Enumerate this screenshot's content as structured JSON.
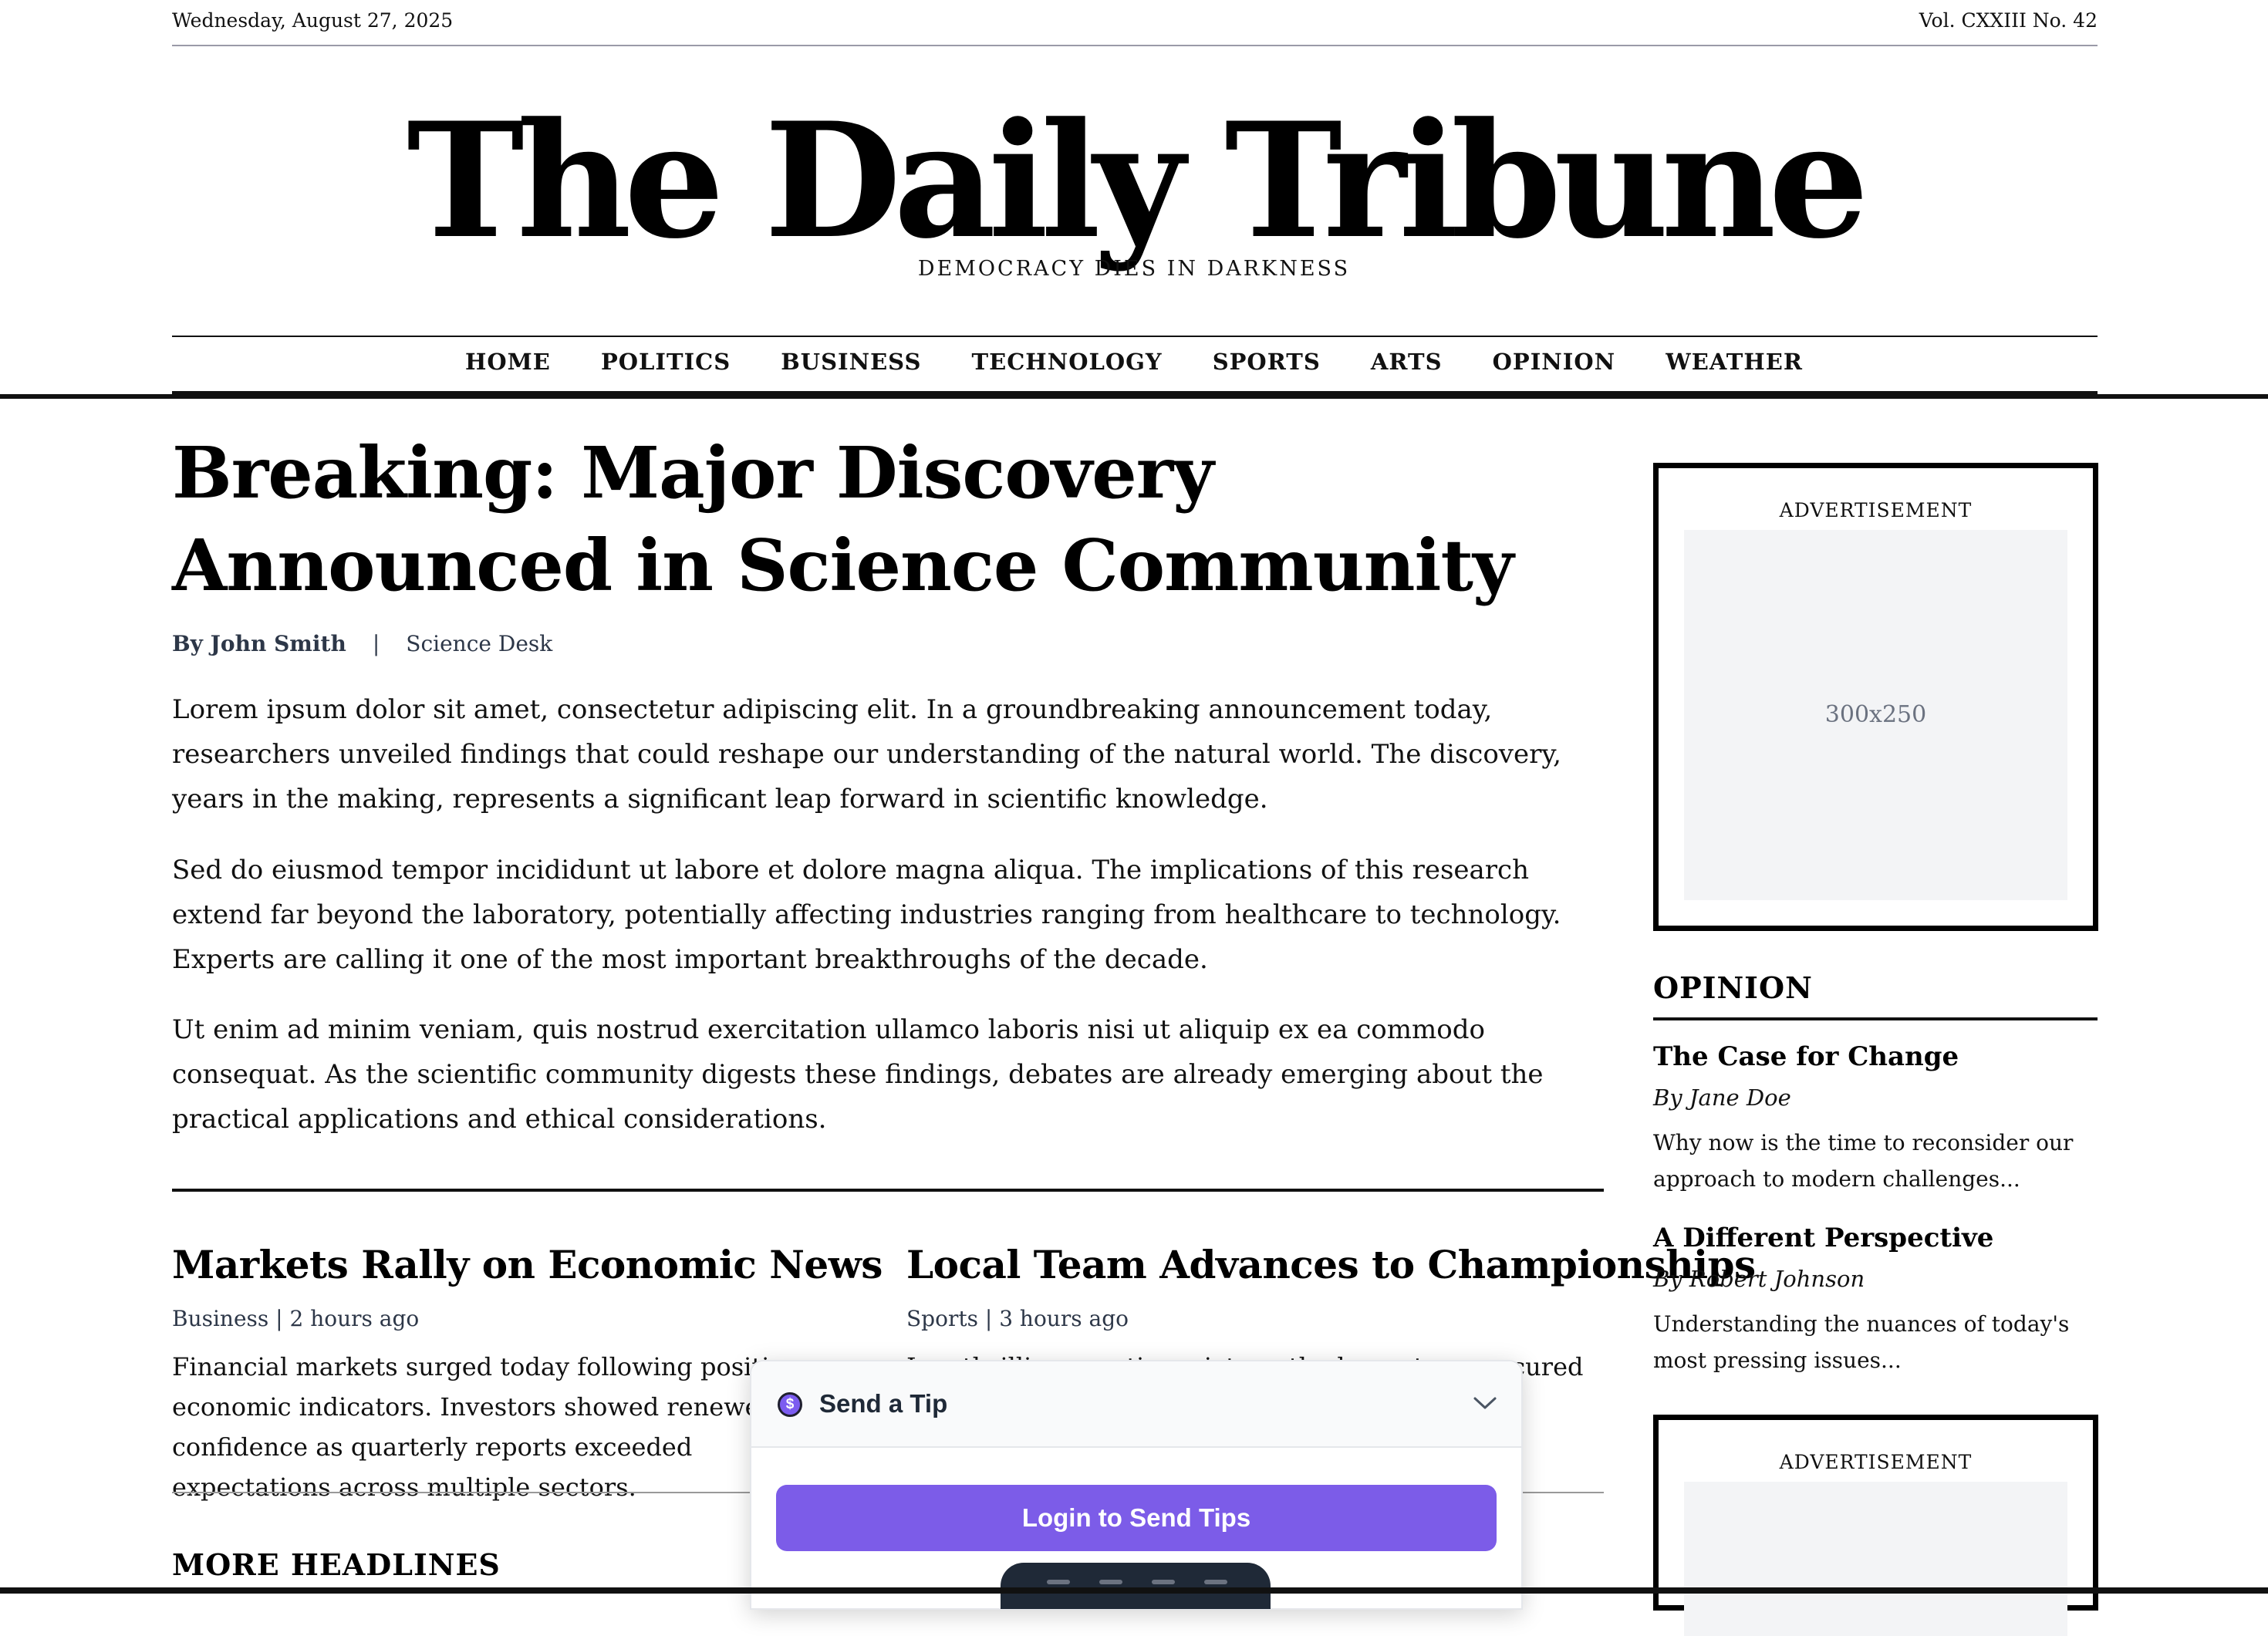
{
  "topbar": {
    "date": "Wednesday, August 27, 2025",
    "volume": "Vol. CXXIII No. 42"
  },
  "masthead": {
    "title": "The Daily Tribune",
    "tagline": "DEMOCRACY DIES IN DARKNESS"
  },
  "nav": {
    "items": [
      "HOME",
      "POLITICS",
      "BUSINESS",
      "TECHNOLOGY",
      "SPORTS",
      "ARTS",
      "OPINION",
      "WEATHER"
    ]
  },
  "main_article": {
    "headline": "Breaking: Major Discovery Announced in Science Community",
    "author": "By John Smith",
    "separator": "|",
    "desk": "Science Desk",
    "paragraphs": [
      "Lorem ipsum dolor sit amet, consectetur adipiscing elit. In a groundbreaking announcement today, researchers unveiled findings that could reshape our understanding of the natural world. The discovery, years in the making, represents a significant leap forward in scientific knowledge.",
      "Sed do eiusmod tempor incididunt ut labore et dolore magna aliqua. The implications of this research extend far beyond the laboratory, potentially affecting industries ranging from healthcare to technology. Experts are calling it one of the most important breakthroughs of the decade.",
      "Ut enim ad minim veniam, quis nostrud exercitation ullamco laboris nisi ut aliquip ex ea commodo consequat. As the scientific community digests these findings, debates are already emerging about the practical applications and ethical considerations."
    ]
  },
  "stories": [
    {
      "title": "Markets Rally on Economic News",
      "meta": "Business | 2 hours ago",
      "text": "Financial markets surged today following positive economic indicators. Investors showed renewed confidence as quarterly reports exceeded expectations across multiple sectors."
    },
    {
      "title": "Local Team Advances to Championships",
      "meta": "Sports | 3 hours ago",
      "text": "In a thrilling overtime victory, the home team secured their spot in the championship round."
    }
  ],
  "more_headlines": {
    "title": "MORE HEADLINES"
  },
  "sidebar": {
    "ad1": {
      "label": "ADVERTISEMENT",
      "size": "300x250"
    },
    "ad2": {
      "label": "ADVERTISEMENT"
    },
    "opinion": {
      "title": "OPINION",
      "items": [
        {
          "title": "The Case for Change",
          "author": "By Jane Doe",
          "excerpt": "Why now is the time to reconsider our approach to modern challenges..."
        },
        {
          "title": "A Different Perspective",
          "author": "By Robert Johnson",
          "excerpt": "Understanding the nuances of today's most pressing issues..."
        }
      ]
    }
  },
  "tip_widget": {
    "coin_symbol": "$",
    "title": "Send a Tip",
    "login_label": "Login to Send Tips",
    "accent": "#7c5ce8"
  }
}
